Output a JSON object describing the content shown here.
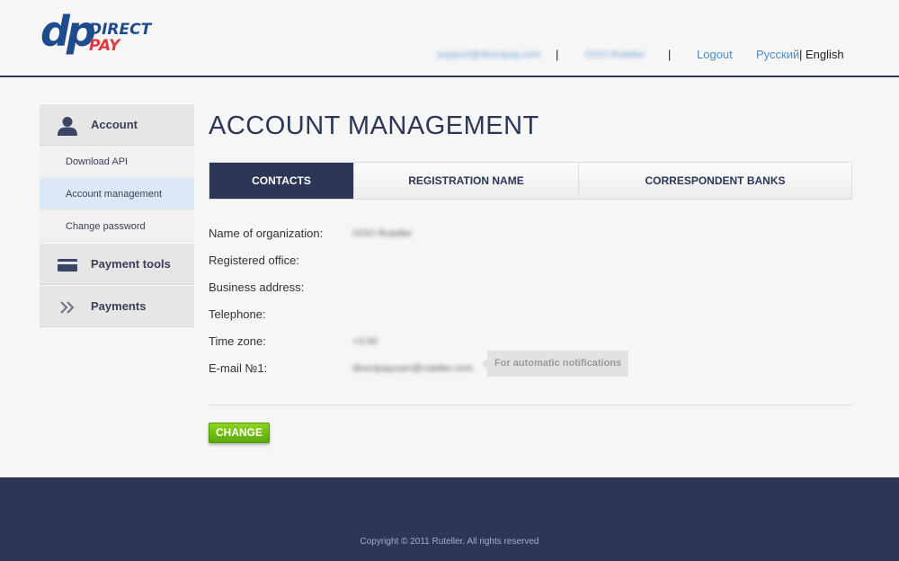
{
  "header": {
    "logo": {
      "mark": "dp",
      "line1": "DIRECT",
      "line2": "PAY"
    },
    "user_email": "support@directpay.com",
    "company": "OOO Ruteller",
    "separator": "|",
    "logout": "Logout",
    "lang_ru": "Русский",
    "lang_sep": "|",
    "lang_en": "English"
  },
  "sidebar": {
    "account_label": "Account",
    "account_items": [
      "Download API",
      "Account management",
      "Change password"
    ],
    "payment_tools_label": "Payment tools",
    "payments_label": "Payments"
  },
  "main": {
    "title": "ACCOUNT MANAGEMENT",
    "tabs": [
      "CONTACTS",
      "REGISTRATION NAME",
      "CORRESPONDENT BANKS"
    ],
    "fields": {
      "organization": {
        "label": "Name of organization:",
        "value": "OOO Ruteller"
      },
      "registered_office": {
        "label": "Registered office:"
      },
      "business_address": {
        "label": "Business address:"
      },
      "telephone": {
        "label": "Telephone:"
      },
      "time_zone": {
        "label": "Time zone:",
        "value": "+3:00"
      },
      "email": {
        "label": "E-mail №1:",
        "value": "directpayuser@ruteller.com"
      }
    },
    "email_hint": "For automatic notifications",
    "change_button": "CHANGE"
  },
  "footer": {
    "copyright": "Copyright © 2011 Ruteller. All rights reserved"
  },
  "colors": {
    "brand_navy": "#2c3656",
    "brand_blue": "#1e4b8c",
    "brand_red": "#e03a3e",
    "link_blue": "#4a8dc2",
    "button_green": "#6dbb10",
    "active_sidebar": "#dbe9f6"
  }
}
